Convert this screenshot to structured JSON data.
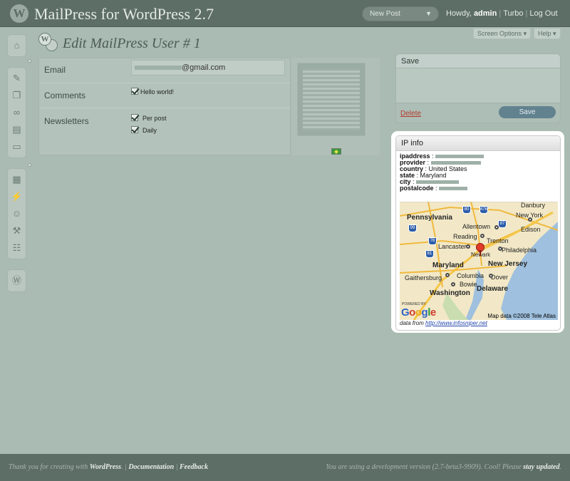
{
  "header": {
    "site_title": "MailPress for WordPress 2.7",
    "new_post": "New Post",
    "howdy": "Howdy,",
    "username": "admin",
    "turbo": "Turbo",
    "logout": "Log Out"
  },
  "screen_options": "Screen Options",
  "help": "Help",
  "page_title": "Edit MailPress User # 1",
  "form": {
    "email_label": "Email",
    "email_value": "@gmail.com",
    "comments_label": "Comments",
    "comments_option": "Hello world!",
    "newsletters_label": "Newsletters",
    "newsletter_options": [
      "Per post",
      "Daily"
    ]
  },
  "save_box": {
    "title": "Save",
    "delete": "Delete",
    "save": "Save"
  },
  "ip_info": {
    "title": "IP info",
    "fields": [
      {
        "key": "ipaddress",
        "value": ""
      },
      {
        "key": "provider",
        "value": ""
      },
      {
        "key": "country",
        "value": "United States"
      },
      {
        "key": "state",
        "value": "Maryland"
      },
      {
        "key": "city",
        "value": ""
      },
      {
        "key": "postalcode",
        "value": ""
      }
    ],
    "data_from": "data from",
    "data_from_link": "http://www.infosniper.net"
  },
  "map": {
    "labels": [
      "Pennsylvania",
      "New York",
      "Allentown",
      "Reading",
      "Trenton",
      "Edison",
      "Lancaster",
      "Philadelphia",
      "Newark",
      "Maryland",
      "New Jersey",
      "Gaithersburg",
      "Columbia",
      "Dover",
      "Bowie",
      "Delaware",
      "Washington",
      "Danbury"
    ],
    "shields": [
      "99",
      "80",
      "476",
      "87",
      "76",
      "81"
    ],
    "google": "Google",
    "powered_by": "POWERED BY",
    "credit": "Map data ©2008 Tele Atlas"
  },
  "footer": {
    "thanks": "Thank you for creating with",
    "wordpress": "WordPress",
    "documentation": "Documentation",
    "feedback": "Feedback",
    "version_text": "You are using a development version (2.7-beta3-9909). Cool! Please",
    "stay_updated": "stay updated"
  }
}
